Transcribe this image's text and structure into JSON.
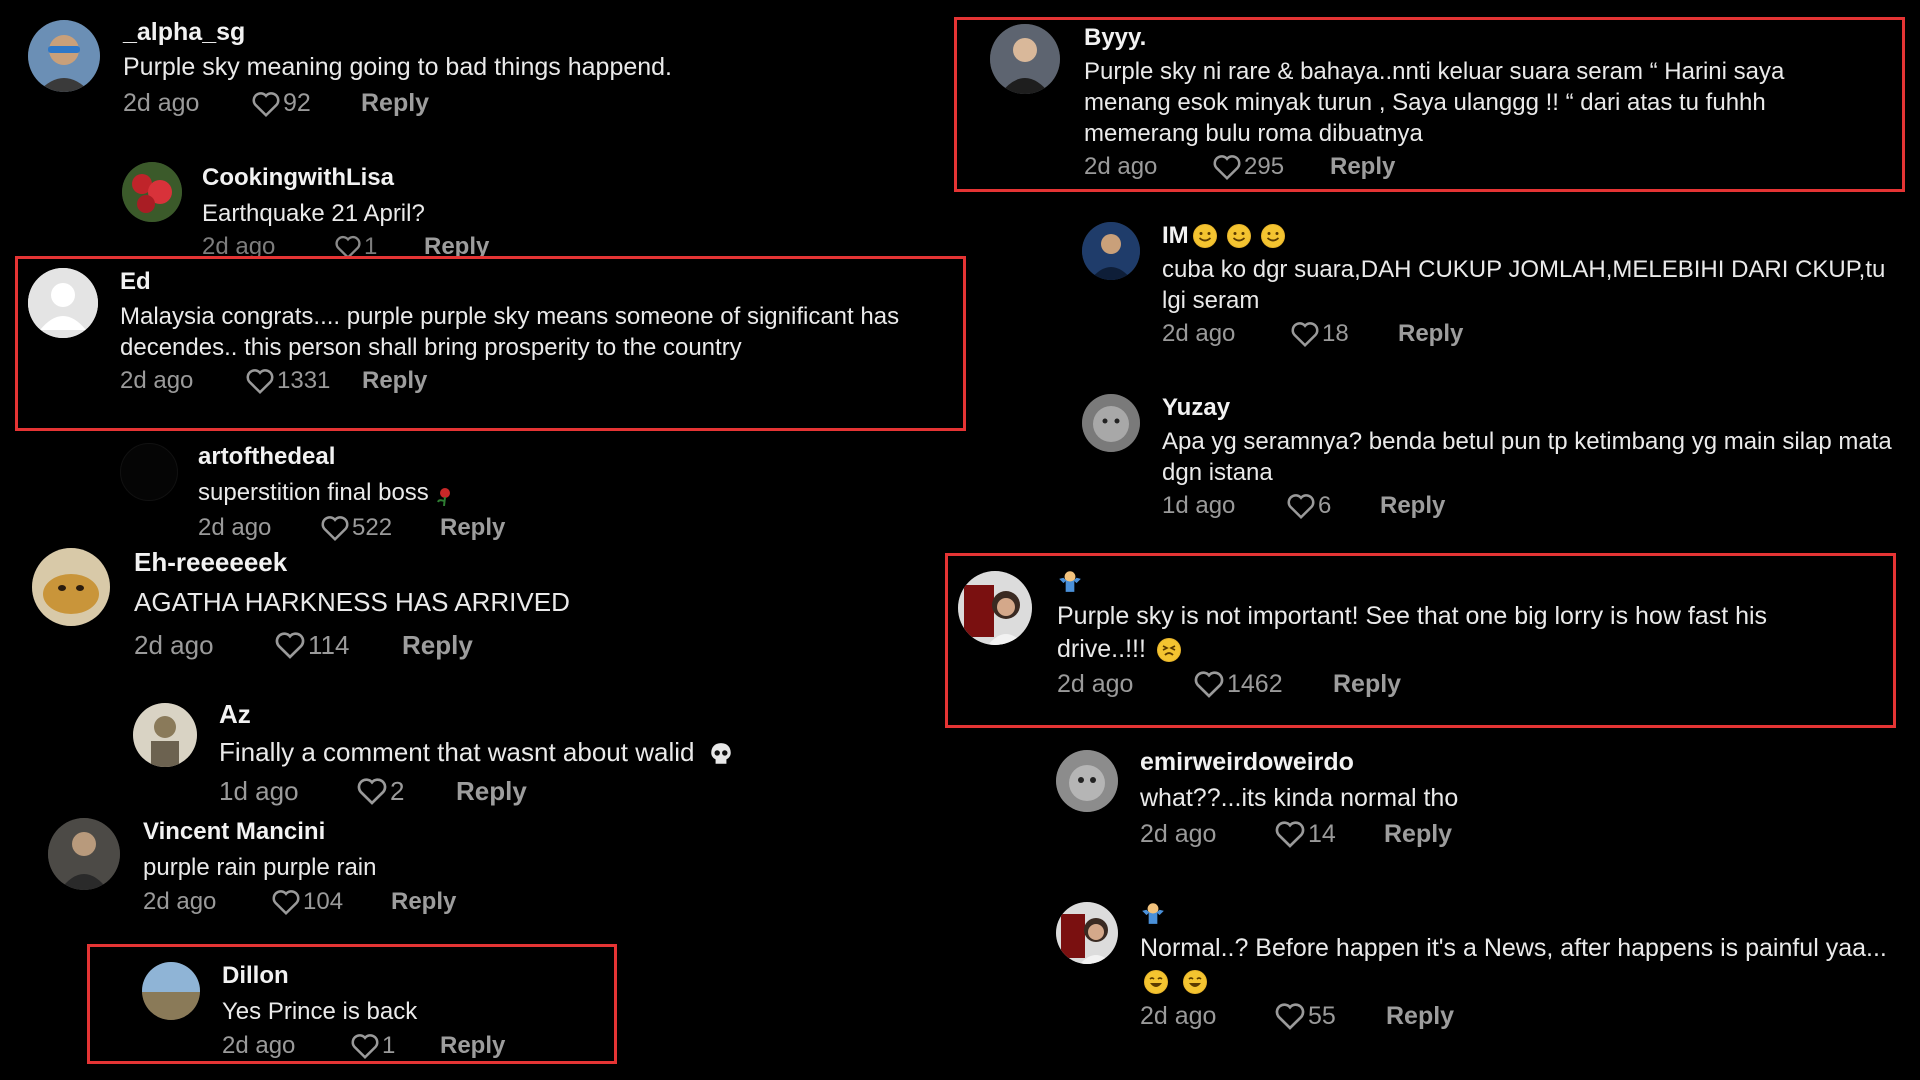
{
  "colors": {
    "background": "#000000",
    "highlight": "#e53434",
    "username": "#f2f2f2",
    "meta": "#9a9a9a"
  },
  "heart_icon": "heart-outline-icon",
  "comments": [
    {
      "username": "_alpha_sg",
      "text": "Purple sky meaning going to bad things happend.",
      "time": "2d ago",
      "likes": "92",
      "reply": "Reply",
      "highlighted": false
    },
    {
      "username": "CookingwithLisa",
      "text": "Earthquake 21 April?",
      "time": "2d ago",
      "likes": "1",
      "reply": "Reply",
      "highlighted": false
    },
    {
      "username": "Ed",
      "text": "Malaysia congrats.... purple purple sky means someone of significant has decendes.. this person shall bring prosperity to the country",
      "time": "2d ago",
      "likes": "1331",
      "reply": "Reply",
      "highlighted": true
    },
    {
      "username": "artofthedeal",
      "text": "superstition final boss",
      "time": "2d ago",
      "likes": "522",
      "reply": "Reply",
      "highlighted": false
    },
    {
      "username": "Eh-reeeeeek",
      "text": "AGATHA HARKNESS HAS ARRIVED",
      "time": "2d ago",
      "likes": "114",
      "reply": "Reply",
      "highlighted": false
    },
    {
      "username": "Az",
      "text": "Finally a comment that wasnt about walid",
      "time": "1d ago",
      "likes": "2",
      "reply": "Reply",
      "highlighted": false
    },
    {
      "username": "Vincent Mancini",
      "text": "purple rain purple rain",
      "time": "2d ago",
      "likes": "104",
      "reply": "Reply",
      "highlighted": false
    },
    {
      "username": "Dillon",
      "text": "Yes Prince is back",
      "time": "2d ago",
      "likes": "1",
      "reply": "Reply",
      "highlighted": true
    },
    {
      "username": "Byyy.",
      "text": "Purple sky ni rare & bahaya..nnti keluar suara seram “ Harini saya menang esok minyak turun , Saya ulanggg !! “ dari atas tu fuhhh memerang bulu roma dibuatnya",
      "time": "2d ago",
      "likes": "295",
      "reply": "Reply",
      "highlighted": true
    },
    {
      "username": "IM",
      "text": "cuba ko dgr suara,DAH CUKUP JOMLAH,MELEBIHI DARI CKUP,tu lgi seram",
      "time": "2d ago",
      "likes": "18",
      "reply": "Reply",
      "highlighted": false
    },
    {
      "username": "Yuzay",
      "text": "Apa yg seramnya? benda betul pun tp ketimbang yg main silap mata dgn istana",
      "time": "1d ago",
      "likes": "6",
      "reply": "Reply",
      "highlighted": false
    },
    {
      "username": "",
      "text": "Purple sky is not important! See that one big lorry is how fast his drive..!!!",
      "time": "2d ago",
      "likes": "1462",
      "reply": "Reply",
      "highlighted": true
    },
    {
      "username": "emirweirdoweirdo",
      "text": "what??...its kinda normal tho",
      "time": "2d ago",
      "likes": "14",
      "reply": "Reply",
      "highlighted": false
    },
    {
      "username": "",
      "text": "Normal..? Before happen it's a News, after happens is painful yaa...",
      "time": "2d ago",
      "likes": "55",
      "reply": "Reply",
      "highlighted": false
    }
  ]
}
